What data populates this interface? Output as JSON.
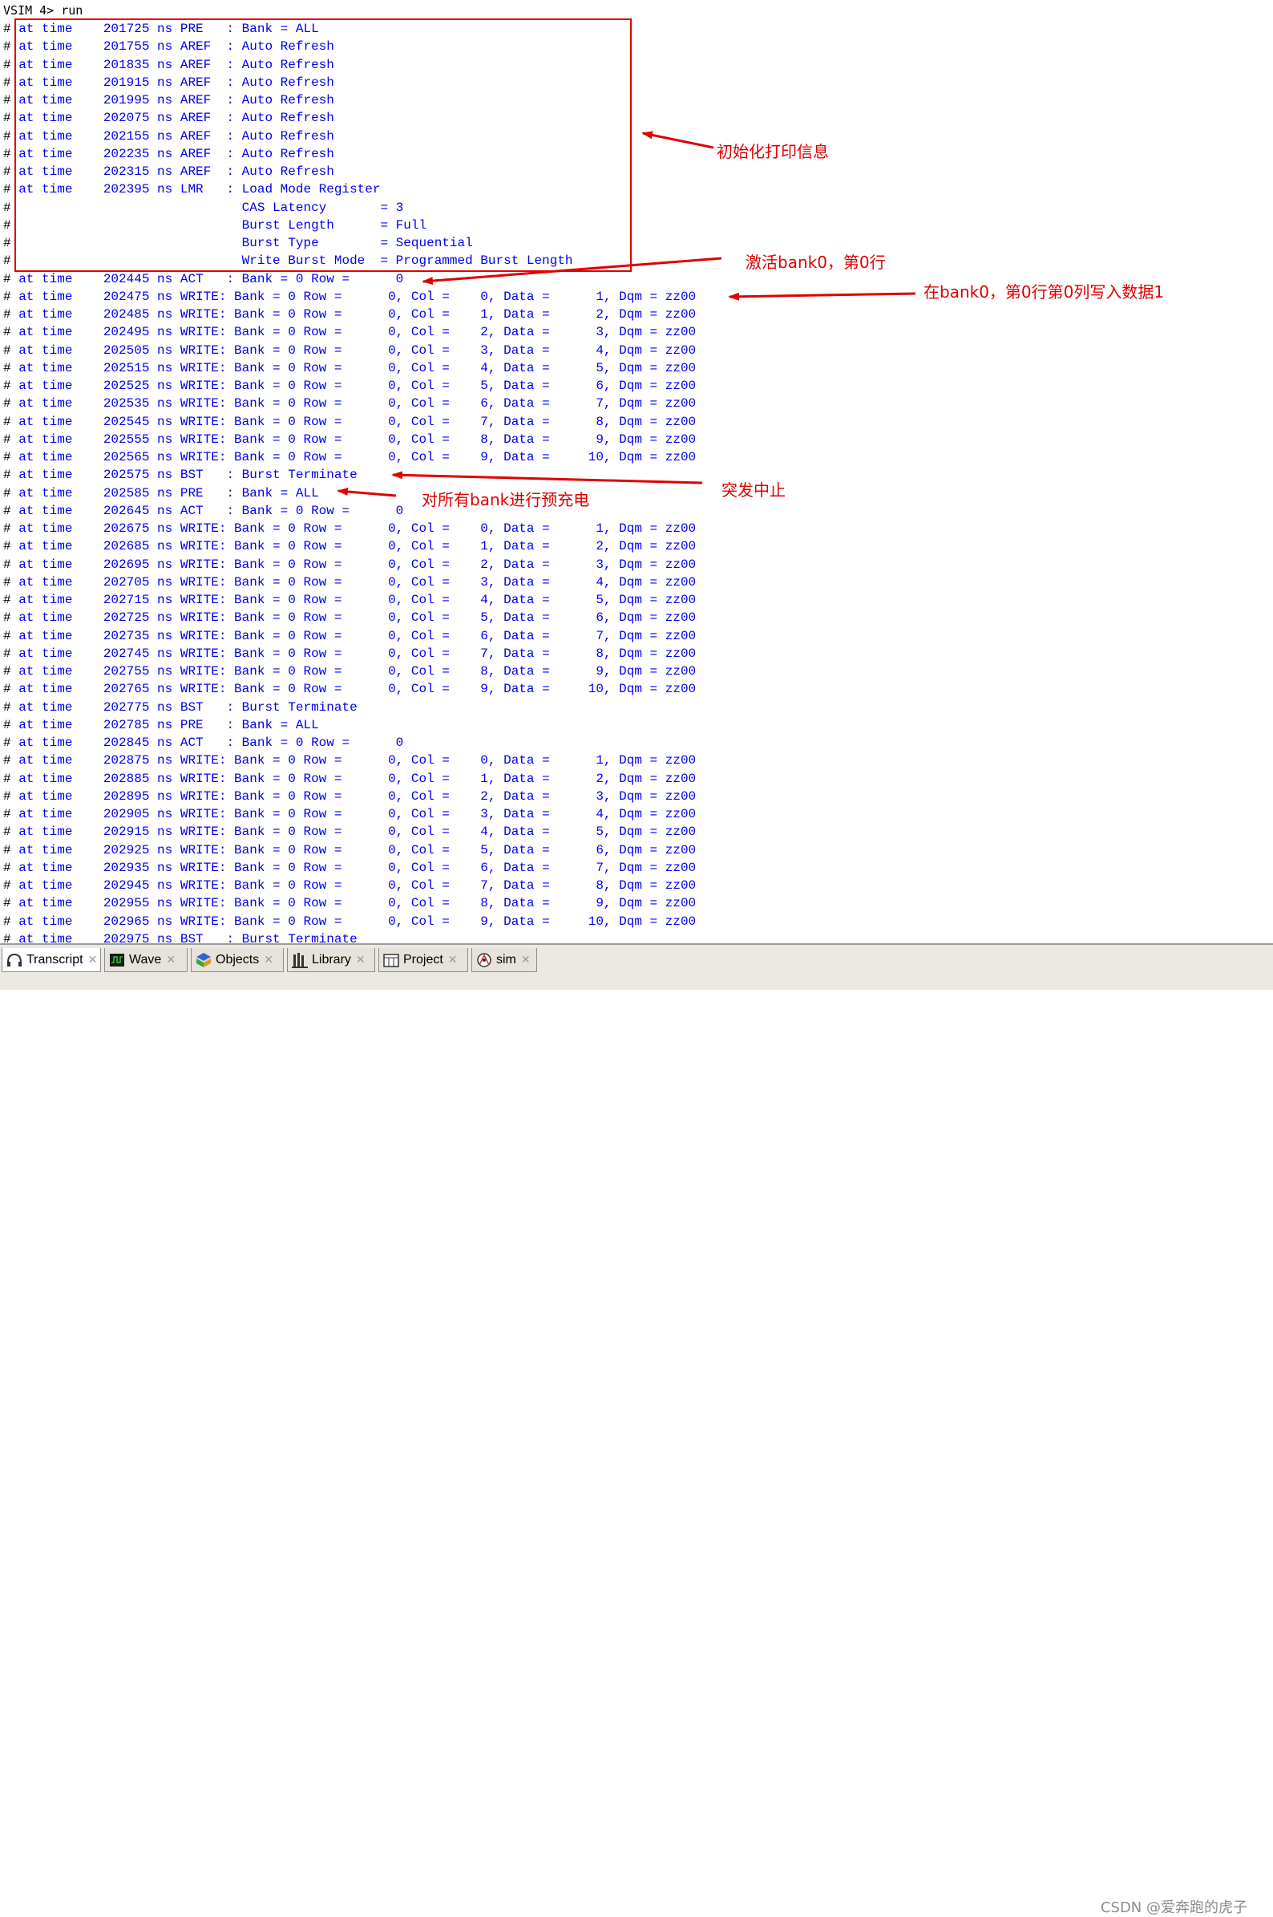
{
  "console": {
    "prompt": "VSIM 4> run",
    "lines": [
      "at time    201725 ns PRE   : Bank = ALL",
      "at time    201755 ns AREF  : Auto Refresh",
      "at time    201835 ns AREF  : Auto Refresh",
      "at time    201915 ns AREF  : Auto Refresh",
      "at time    201995 ns AREF  : Auto Refresh",
      "at time    202075 ns AREF  : Auto Refresh",
      "at time    202155 ns AREF  : Auto Refresh",
      "at time    202235 ns AREF  : Auto Refresh",
      "at time    202315 ns AREF  : Auto Refresh",
      "at time    202395 ns LMR   : Load Mode Register",
      "                             CAS Latency       = 3",
      "                             Burst Length      = Full",
      "                             Burst Type        = Sequential",
      "                             Write Burst Mode  = Programmed Burst Length",
      "at time    202445 ns ACT   : Bank = 0 Row =      0",
      "at time    202475 ns WRITE: Bank = 0 Row =      0, Col =    0, Data =      1, Dqm = zz00",
      "at time    202485 ns WRITE: Bank = 0 Row =      0, Col =    1, Data =      2, Dqm = zz00",
      "at time    202495 ns WRITE: Bank = 0 Row =      0, Col =    2, Data =      3, Dqm = zz00",
      "at time    202505 ns WRITE: Bank = 0 Row =      0, Col =    3, Data =      4, Dqm = zz00",
      "at time    202515 ns WRITE: Bank = 0 Row =      0, Col =    4, Data =      5, Dqm = zz00",
      "at time    202525 ns WRITE: Bank = 0 Row =      0, Col =    5, Data =      6, Dqm = zz00",
      "at time    202535 ns WRITE: Bank = 0 Row =      0, Col =    6, Data =      7, Dqm = zz00",
      "at time    202545 ns WRITE: Bank = 0 Row =      0, Col =    7, Data =      8, Dqm = zz00",
      "at time    202555 ns WRITE: Bank = 0 Row =      0, Col =    8, Data =      9, Dqm = zz00",
      "at time    202565 ns WRITE: Bank = 0 Row =      0, Col =    9, Data =     10, Dqm = zz00",
      "at time    202575 ns BST   : Burst Terminate",
      "at time    202585 ns PRE   : Bank = ALL",
      "at time    202645 ns ACT   : Bank = 0 Row =      0",
      "at time    202675 ns WRITE: Bank = 0 Row =      0, Col =    0, Data =      1, Dqm = zz00",
      "at time    202685 ns WRITE: Bank = 0 Row =      0, Col =    1, Data =      2, Dqm = zz00",
      "at time    202695 ns WRITE: Bank = 0 Row =      0, Col =    2, Data =      3, Dqm = zz00",
      "at time    202705 ns WRITE: Bank = 0 Row =      0, Col =    3, Data =      4, Dqm = zz00",
      "at time    202715 ns WRITE: Bank = 0 Row =      0, Col =    4, Data =      5, Dqm = zz00",
      "at time    202725 ns WRITE: Bank = 0 Row =      0, Col =    5, Data =      6, Dqm = zz00",
      "at time    202735 ns WRITE: Bank = 0 Row =      0, Col =    6, Data =      7, Dqm = zz00",
      "at time    202745 ns WRITE: Bank = 0 Row =      0, Col =    7, Data =      8, Dqm = zz00",
      "at time    202755 ns WRITE: Bank = 0 Row =      0, Col =    8, Data =      9, Dqm = zz00",
      "at time    202765 ns WRITE: Bank = 0 Row =      0, Col =    9, Data =     10, Dqm = zz00",
      "at time    202775 ns BST   : Burst Terminate",
      "at time    202785 ns PRE   : Bank = ALL",
      "at time    202845 ns ACT   : Bank = 0 Row =      0",
      "at time    202875 ns WRITE: Bank = 0 Row =      0, Col =    0, Data =      1, Dqm = zz00",
      "at time    202885 ns WRITE: Bank = 0 Row =      0, Col =    1, Data =      2, Dqm = zz00",
      "at time    202895 ns WRITE: Bank = 0 Row =      0, Col =    2, Data =      3, Dqm = zz00",
      "at time    202905 ns WRITE: Bank = 0 Row =      0, Col =    3, Data =      4, Dqm = zz00",
      "at time    202915 ns WRITE: Bank = 0 Row =      0, Col =    4, Data =      5, Dqm = zz00",
      "at time    202925 ns WRITE: Bank = 0 Row =      0, Col =    5, Data =      6, Dqm = zz00",
      "at time    202935 ns WRITE: Bank = 0 Row =      0, Col =    6, Data =      7, Dqm = zz00",
      "at time    202945 ns WRITE: Bank = 0 Row =      0, Col =    7, Data =      8, Dqm = zz00",
      "at time    202955 ns WRITE: Bank = 0 Row =      0, Col =    8, Data =      9, Dqm = zz00",
      "at time    202965 ns WRITE: Bank = 0 Row =      0, Col =    9, Data =     10, Dqm = zz00",
      "at time    202975 ns BST   : Burst Terminate"
    ]
  },
  "annotations": {
    "init_info": "初始化打印信息",
    "activate_bank0_row0": "激活bank0，第0行",
    "write_data_1": "在bank0，第0行第0列写入数据1",
    "burst_terminate": "突发中止",
    "precharge_all": "对所有bank进行预充电"
  },
  "tabs": [
    {
      "label": "Transcript",
      "icon": "transcript-icon",
      "active": true
    },
    {
      "label": "Wave",
      "icon": "wave-icon",
      "active": false
    },
    {
      "label": "Objects",
      "icon": "objects-icon",
      "active": false
    },
    {
      "label": "Library",
      "icon": "library-icon",
      "active": false
    },
    {
      "label": "Project",
      "icon": "project-icon",
      "active": false
    },
    {
      "label": "sim",
      "icon": "sim-icon",
      "active": false
    }
  ],
  "watermark": "CSDN @爱奔跑的虎子",
  "colors": {
    "log_text": "#0000ee",
    "annotation": "#e00000",
    "tab_bar": "#ece9e3"
  }
}
